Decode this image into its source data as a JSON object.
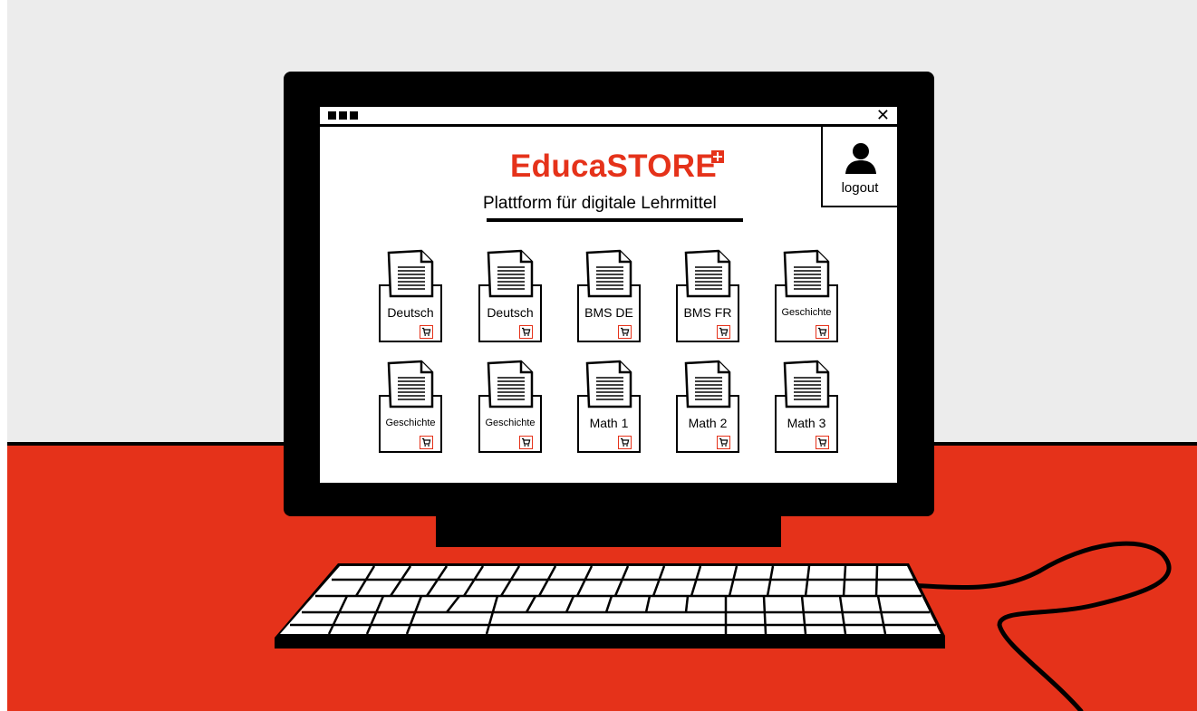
{
  "colors": {
    "brand_red": "#e5321a",
    "desk_red": "#e5321a",
    "wall_grey": "#ececec",
    "outline": "#000000",
    "screen_bg": "#ffffff"
  },
  "window": {
    "dots_icon": "window-dots-icon",
    "close_label": "✕"
  },
  "header": {
    "brand": "EducaSTORE",
    "brand_mark": "swiss-cross-icon",
    "subtitle": "Plattform für digitale Lehrmittel"
  },
  "account": {
    "icon": "user-icon",
    "logout_label": "logout"
  },
  "products": [
    {
      "label": "Deutsch",
      "size": "normal"
    },
    {
      "label": "Deutsch",
      "size": "normal"
    },
    {
      "label": "BMS DE",
      "size": "normal"
    },
    {
      "label": "BMS FR",
      "size": "normal"
    },
    {
      "label": "Geschichte",
      "size": "small"
    },
    {
      "label": "Geschichte",
      "size": "small"
    },
    {
      "label": "Geschichte",
      "size": "small"
    },
    {
      "label": "Math 1",
      "size": "normal"
    },
    {
      "label": "Math 2",
      "size": "normal"
    },
    {
      "label": "Math 3",
      "size": "normal"
    }
  ],
  "product_icons": {
    "document": "document-icon",
    "cart": "cart-icon"
  }
}
